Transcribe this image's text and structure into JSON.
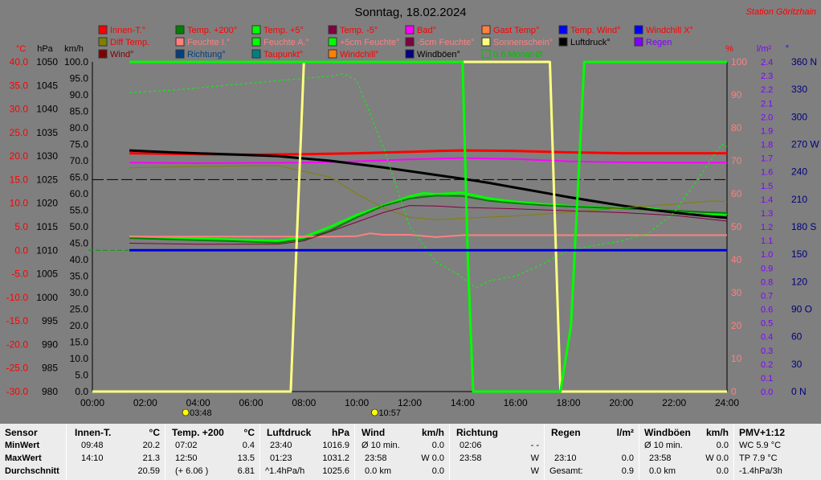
{
  "title": "Sonntag, 18.02.2024",
  "station": "Station Göritzhain",
  "legend": [
    {
      "label": "Innen-T.°",
      "color": "#ff0000",
      "text_color": "#ff0000"
    },
    {
      "label": "Temp. +200°",
      "color": "#008000",
      "text_color": "#ff0000"
    },
    {
      "label": "Temp. +5°",
      "color": "#00ff00",
      "text_color": "#ff0000"
    },
    {
      "label": "Temp. -5°",
      "color": "#800040",
      "text_color": "#ff0000"
    },
    {
      "label": "Bad°",
      "color": "#ff00ff",
      "text_color": "#ff0000"
    },
    {
      "label": "Gast Temp°",
      "color": "#ff8040",
      "text_color": "#ff0000"
    },
    {
      "label": "Temp. Wind°",
      "color": "#0000ff",
      "text_color": "#ff0000"
    },
    {
      "label": "Windchill X°",
      "color": "#0000ff",
      "text_color": "#ff0000"
    },
    {
      "label": "Diff Temp.",
      "color": "#808000",
      "text_color": "#ff0000"
    },
    {
      "label": "Feuchte I.°",
      "color": "#ff8080",
      "text_color": "#ff8080"
    },
    {
      "label": "Feuchte A.°",
      "color": "#00ff00",
      "text_color": "#ff8080"
    },
    {
      "label": "+5cm Feuchte°",
      "color": "#00ff00",
      "text_color": "#ff8080"
    },
    {
      "label": "-5cm Feuchte°",
      "color": "#800040",
      "text_color": "#ff8080"
    },
    {
      "label": "Sonnenschein°",
      "color": "#ffff80",
      "text_color": "#ff8080"
    },
    {
      "label": "Luftdruck°",
      "color": "#000000",
      "text_color": "#000000"
    },
    {
      "label": "Regen",
      "color": "#8000ff",
      "text_color": "#8000ff"
    },
    {
      "label": "Wind°",
      "color": "#800000",
      "text_color": "#800000"
    },
    {
      "label": "Richtung°",
      "color": "#004080",
      "text_color": "#004080"
    },
    {
      "label": "Taupunkt°",
      "color": "#008080",
      "text_color": "#ff0000"
    },
    {
      "label": "Windchill°",
      "color": "#ff8000",
      "text_color": "#ff0000"
    },
    {
      "label": "Windböen°",
      "color": "#000080",
      "text_color": "#000000"
    },
    {
      "label": "0.8 Monat-Ø",
      "color": "#00c000",
      "text_color": "#00c000",
      "dashed": true
    }
  ],
  "axis_units": {
    "temp": "°C",
    "hpa": "hPa",
    "kmh": "km/h",
    "percent": "%",
    "radiation": "l/m²",
    "direction": "°"
  },
  "markers": {
    "sunrise": "03:48",
    "sunset": "10:57"
  },
  "chart_data": {
    "type": "line",
    "x_unit": "hour",
    "x_ticks": [
      "00:00",
      "02:00",
      "04:00",
      "06:00",
      "08:00",
      "10:00",
      "12:00",
      "14:00",
      "16:00",
      "18:00",
      "20:00",
      "22:00",
      "24:00"
    ],
    "xlim": [
      0,
      24
    ],
    "axes": {
      "temp_c": {
        "ylim": [
          -30,
          40
        ],
        "ticks": [
          "40.0",
          "35.0",
          "30.0",
          "25.0",
          "20.0",
          "15.0",
          "10.0",
          "5.0",
          "0.0",
          "-5.0",
          "-10.0",
          "-15.0",
          "-20.0",
          "-25.0",
          "-30.0"
        ]
      },
      "hpa": {
        "ylim": [
          980,
          1050
        ],
        "ticks": [
          "1050",
          "1045",
          "1040",
          "1035",
          "1030",
          "1025",
          "1020",
          "1015",
          "1010",
          "1005",
          "1000",
          "995",
          "990",
          "985",
          "980"
        ]
      },
      "kmh": {
        "ylim": [
          0,
          100
        ],
        "ticks": [
          "100.0",
          "95.0",
          "90.0",
          "85.0",
          "80.0",
          "75.0",
          "70.0",
          "65.0",
          "60.0",
          "55.0",
          "50.0",
          "45.0",
          "40.0",
          "35.0",
          "30.0",
          "25.0",
          "20.0",
          "15.0",
          "10.0",
          "5.0",
          "0.0"
        ]
      },
      "percent": {
        "ylim": [
          0,
          100
        ],
        "ticks": [
          "100",
          "90",
          "80",
          "70",
          "60",
          "50",
          "40",
          "30",
          "20",
          "10",
          "0"
        ]
      },
      "radiation": {
        "ylim": [
          0,
          2.4
        ],
        "ticks": [
          "2.4",
          "2.3",
          "2.2",
          "2.1",
          "2.0",
          "1.9",
          "1.8",
          "1.7",
          "1.6",
          "1.5",
          "1.4",
          "1.3",
          "1.2",
          "1.1",
          "1.0",
          "0.9",
          "0.8",
          "0.7",
          "0.6",
          "0.5",
          "0.4",
          "0.3",
          "0.2",
          "0.1",
          "0.0"
        ]
      },
      "direction": {
        "ylim": [
          0,
          360
        ],
        "ticks": [
          "360 N",
          "330",
          "300",
          "270 W",
          "240",
          "210",
          "180 S",
          "150",
          "120",
          "90 O",
          "60",
          "30",
          "0  N"
        ]
      }
    },
    "reference_line_temp_c": 15.0,
    "series": [
      {
        "name": "Innen-T.°",
        "axis": "temp_c",
        "color": "#ff0000",
        "width": 3,
        "x": [
          1.4,
          4,
          6,
          8,
          10,
          12,
          13,
          14,
          16,
          18,
          20,
          22,
          24
        ],
        "y": [
          20.6,
          20.4,
          20.3,
          20.4,
          20.6,
          20.9,
          21.1,
          21.2,
          21.1,
          20.8,
          20.6,
          20.6,
          20.6
        ]
      },
      {
        "name": "Temp. +5°",
        "axis": "temp_c",
        "color": "#00ff00",
        "width": 3,
        "x": [
          1.4,
          3,
          5,
          7,
          8,
          9,
          10,
          11,
          12,
          12.5,
          13,
          14,
          15,
          16,
          17,
          18,
          19,
          20,
          21,
          22,
          23,
          24
        ],
        "y": [
          2.9,
          2.6,
          2.3,
          2.0,
          2.8,
          5.0,
          7.5,
          9.5,
          11.4,
          12.1,
          11.9,
          12.2,
          11.0,
          10.3,
          9.8,
          9.4,
          9.1,
          8.9,
          8.9,
          8.2,
          7.5,
          7.8
        ]
      },
      {
        "name": "Temp. +200°",
        "axis": "temp_c",
        "color": "#008000",
        "width": 2,
        "x": [
          1.4,
          3,
          5,
          7,
          8,
          9,
          10,
          11,
          12,
          13,
          14,
          15,
          16,
          17,
          18,
          20,
          22,
          24
        ],
        "y": [
          2.6,
          2.3,
          2.0,
          1.6,
          2.3,
          4.2,
          7.0,
          9.4,
          11.0,
          11.6,
          11.5,
          10.5,
          10.0,
          9.6,
          9.3,
          8.9,
          8.4,
          7.9
        ]
      },
      {
        "name": "Bad°",
        "axis": "temp_c",
        "color": "#ff00ff",
        "width": 2,
        "x": [
          1.4,
          4,
          8,
          10,
          12,
          14,
          16,
          18,
          20,
          22,
          24
        ],
        "y": [
          18.6,
          18.5,
          18.6,
          18.9,
          19.3,
          19.6,
          19.4,
          18.9,
          18.7,
          18.6,
          18.6
        ]
      },
      {
        "name": "Luftdruck°",
        "axis": "hpa",
        "color": "#000000",
        "width": 3,
        "x": [
          1.4,
          3,
          5,
          7,
          8,
          9,
          10,
          11,
          12,
          13,
          14,
          15,
          16,
          17,
          18,
          19,
          20,
          21,
          22,
          23,
          24
        ],
        "y": [
          1031.2,
          1030.8,
          1030.4,
          1030.0,
          1029.5,
          1029.0,
          1028.3,
          1027.6,
          1026.8,
          1026.0,
          1025.2,
          1024.3,
          1023.3,
          1022.3,
          1021.3,
          1020.4,
          1019.5,
          1018.7,
          1018.0,
          1017.4,
          1016.9
        ]
      },
      {
        "name": "Feuchte I.°",
        "axis": "temp_c",
        "color": "#ff8080",
        "width": 2,
        "x": [
          1.4,
          8,
          9,
          10,
          10.5,
          11,
          12,
          13,
          14,
          16,
          18,
          20,
          22,
          24
        ],
        "y": [
          2.9,
          2.9,
          2.9,
          3.0,
          3.6,
          3.3,
          3.3,
          2.8,
          3.2,
          3.2,
          3.2,
          3.2,
          3.2,
          3.2
        ]
      },
      {
        "name": "Diff Temp.",
        "axis": "temp_c",
        "color": "#808000",
        "width": 1,
        "x": [
          1.4,
          4,
          7,
          9,
          10,
          11,
          12,
          13,
          14,
          16,
          18,
          20,
          22,
          23.5,
          24
        ],
        "y": [
          17.5,
          17.8,
          18.0,
          15.5,
          12.0,
          9.0,
          7.0,
          6.5,
          6.8,
          7.3,
          8.0,
          9.0,
          9.8,
          10.5,
          10.3
        ]
      },
      {
        "name": "Temp. -5°",
        "axis": "temp_c",
        "color": "#800040",
        "width": 1,
        "x": [
          1.4,
          4,
          7,
          8,
          9,
          10,
          11,
          12,
          13,
          14,
          16,
          18,
          20,
          22,
          24
        ],
        "y": [
          1.5,
          1.3,
          1.3,
          2.0,
          4.0,
          6.0,
          8.0,
          9.5,
          9.4,
          9.1,
          8.8,
          8.4,
          8.0,
          7.4,
          6.2
        ]
      },
      {
        "name": "+5cm Feuchte°",
        "axis": "temp_c",
        "color": "#00ff00",
        "width": 1,
        "dashed": true,
        "x": [
          1.4,
          3,
          5,
          7,
          8,
          9,
          9.5,
          10,
          11,
          12,
          13,
          13.8,
          14.5,
          15,
          16,
          17,
          18,
          19,
          20,
          21,
          22,
          23,
          23.8,
          24
        ],
        "y": [
          33.5,
          34.0,
          35.0,
          36.0,
          36.5,
          37.0,
          37.5,
          36.0,
          22.0,
          5.0,
          -2.5,
          -5.0,
          -8.0,
          -6.5,
          -5.5,
          -3.0,
          0.0,
          1.0,
          2.0,
          3.5,
          8.0,
          16.0,
          22.5,
          22.0
        ]
      },
      {
        "name": "Sonnenschein°",
        "axis": "percent",
        "color": "#ffff80",
        "width": 3,
        "x": [
          0,
          7.5,
          8.0,
          17.3,
          17.7,
          24
        ],
        "y": [
          0,
          0,
          100,
          100,
          0,
          0
        ]
      },
      {
        "name": "Feuchte A.°",
        "axis": "percent",
        "color": "#00ff00",
        "width": 3,
        "x": [
          1.4,
          14,
          14.2,
          14.4,
          17.7,
          18.1,
          18.6,
          24
        ],
        "y": [
          100,
          100,
          40,
          0,
          0,
          20,
          100,
          100
        ]
      },
      {
        "name": "Temp. Wind°",
        "axis": "temp_c",
        "color": "#0000ff",
        "width": 3,
        "x": [
          1.4,
          24
        ],
        "y": [
          0.0,
          0.0
        ]
      },
      {
        "name": "Windböen°",
        "axis": "kmh",
        "color": "#000080",
        "width": 1,
        "x": [
          1.4,
          24
        ],
        "y": [
          43.0,
          43.0
        ]
      }
    ]
  },
  "bottom": {
    "sensor": {
      "head": "Sensor",
      "rows": [
        "MinWert",
        "MaxWert",
        "Durchschnitt"
      ]
    },
    "innen": {
      "head": "Innen-T.",
      "unit": "°C",
      "rows": [
        [
          "09:48",
          "20.2"
        ],
        [
          "14:10",
          "21.3"
        ],
        [
          "",
          "20.59"
        ]
      ]
    },
    "temp200": {
      "head": "Temp. +200",
      "unit": "°C",
      "rows": [
        [
          "07:02",
          "0.4"
        ],
        [
          "12:50",
          "13.5"
        ],
        [
          "(+ 6.06 )",
          "6.81"
        ]
      ]
    },
    "luftdruck": {
      "head": "Luftdruck",
      "unit": "hPa",
      "rows": [
        [
          "23:40",
          "1016.9"
        ],
        [
          "01:23",
          "1031.2"
        ],
        [
          "^1.4hPa/h",
          "1025.6"
        ]
      ]
    },
    "wind": {
      "head": "Wind",
      "unit": "km/h",
      "rows": [
        [
          "Ø 10 min.",
          "0.0"
        ],
        [
          "23:58",
          "W 0.0"
        ],
        [
          "0.0 km",
          "0.0"
        ]
      ]
    },
    "richtung": {
      "head": "Richtung",
      "rows": [
        [
          "02:06",
          "- -"
        ],
        [
          "23:58",
          "W"
        ],
        [
          "",
          "W"
        ]
      ]
    },
    "regen": {
      "head": "Regen",
      "unit": "l/m²",
      "rows": [
        [
          "",
          ""
        ],
        [
          "23:10",
          "0.0"
        ],
        [
          "Gesamt:",
          "0.9"
        ]
      ]
    },
    "windboeen": {
      "head": "Windböen",
      "unit": "km/h",
      "rows": [
        [
          "Ø 10 min.",
          "0.0"
        ],
        [
          "23:58",
          "W 0.0"
        ],
        [
          "0.0 km",
          "0.0"
        ]
      ]
    },
    "pmv": {
      "head": "PMV+1:12",
      "rows": [
        "WC 5.9 °C",
        "TP 7.9 °C",
        "-1.4hPa/3h"
      ]
    }
  }
}
